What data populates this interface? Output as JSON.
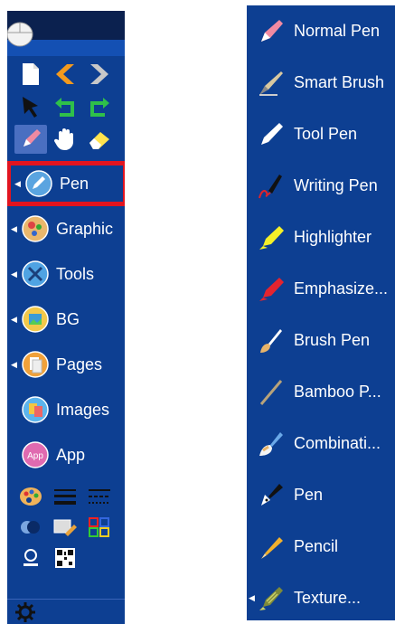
{
  "left_menu": {
    "items": [
      {
        "label": "Pen",
        "icon": "pen-circle-icon",
        "has_arrow": true,
        "selected": true
      },
      {
        "label": "Graphic",
        "icon": "graphic-circle-icon",
        "has_arrow": true
      },
      {
        "label": "Tools",
        "icon": "tools-circle-icon",
        "has_arrow": true
      },
      {
        "label": "BG",
        "icon": "bg-circle-icon",
        "has_arrow": true
      },
      {
        "label": "Pages",
        "icon": "pages-circle-icon",
        "has_arrow": true
      },
      {
        "label": "Images",
        "icon": "images-circle-icon",
        "has_arrow": false
      },
      {
        "label": "App",
        "icon": "app-circle-icon",
        "has_arrow": false
      }
    ],
    "app_badge": "App"
  },
  "pen_menu": {
    "items": [
      {
        "label": "Normal Pen",
        "icon": "normal-pen-icon"
      },
      {
        "label": "Smart Brush",
        "icon": "smart-brush-icon"
      },
      {
        "label": "Tool Pen",
        "icon": "tool-pen-icon"
      },
      {
        "label": "Writing Pen",
        "icon": "writing-pen-icon"
      },
      {
        "label": "Highlighter",
        "icon": "highlighter-icon"
      },
      {
        "label": "Emphasize...",
        "icon": "emphasize-icon"
      },
      {
        "label": "Brush Pen",
        "icon": "brush-pen-icon"
      },
      {
        "label": "Bamboo P...",
        "icon": "bamboo-pen-icon"
      },
      {
        "label": "Combinati...",
        "icon": "combination-icon"
      },
      {
        "label": "Pen",
        "icon": "fountain-pen-icon"
      },
      {
        "label": "Pencil",
        "icon": "pencil-icon"
      },
      {
        "label": "Texture...",
        "icon": "texture-icon",
        "has_arrow": true
      }
    ]
  },
  "colors": {
    "panel_bg": "#0d3f92",
    "selection_border": "#e2141f",
    "highlight_bg": "#4a6fc1"
  }
}
